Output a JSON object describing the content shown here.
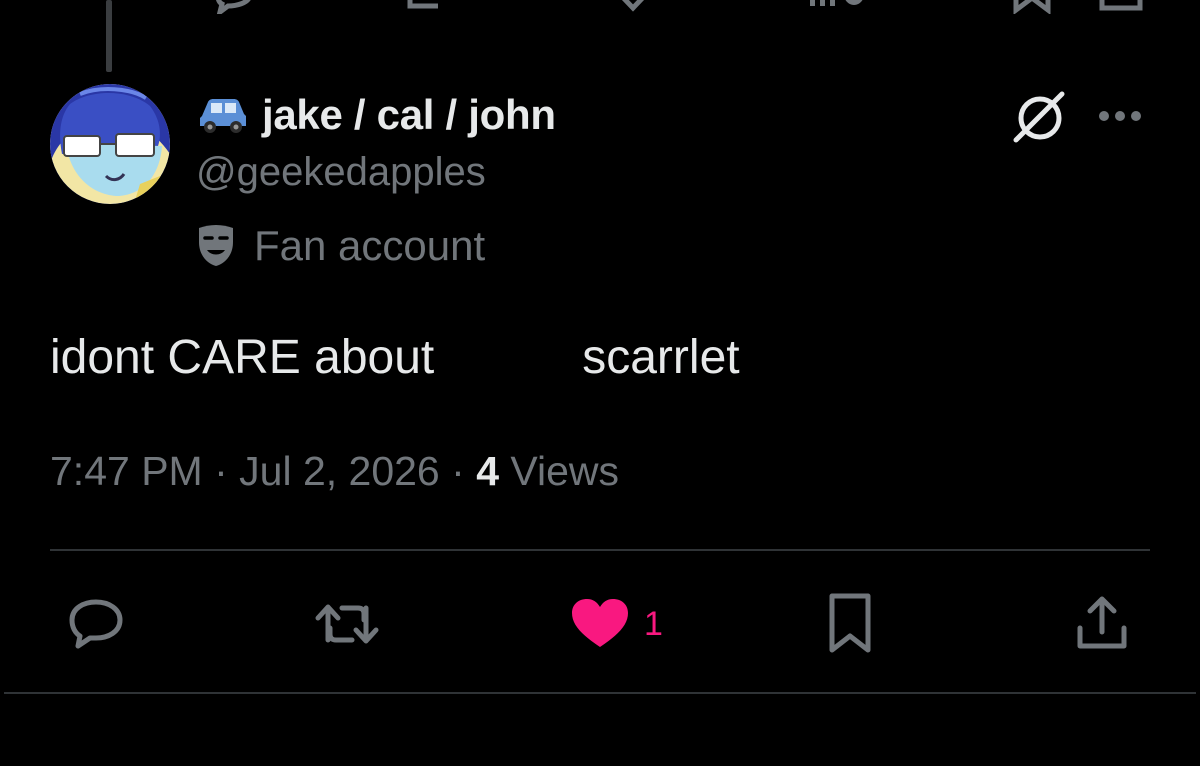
{
  "author": {
    "name_emoji": "🚙",
    "display_name": "jake / cal / john",
    "handle": "@geekedapples",
    "label_icon": "theater-mask-icon",
    "label": "Fan account"
  },
  "tweet": {
    "text_part1": "idont CARE about",
    "text_part2": "scarrlet"
  },
  "meta": {
    "time": "7:47 PM",
    "separator": " · ",
    "date": "Jul 2, 2026",
    "views_count": "4",
    "views_label": " Views"
  },
  "actions": {
    "reply_icon": "reply-icon",
    "repost_icon": "repost-icon",
    "like_icon": "heart-icon",
    "like_count": "1",
    "liked": true,
    "bookmark_icon": "bookmark-icon",
    "share_icon": "share-icon"
  },
  "colors": {
    "background": "#000000",
    "text_primary": "#e7e9ea",
    "text_secondary": "#71767b",
    "like": "#f91880",
    "divider": "#2f3336"
  }
}
